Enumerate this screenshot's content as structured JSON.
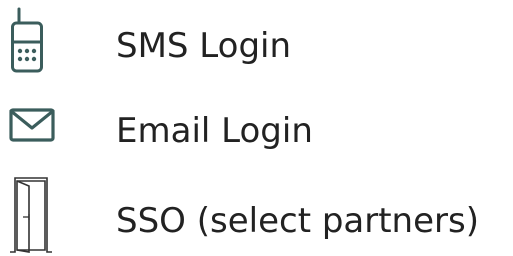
{
  "colors": {
    "icon": "#3b5d5c",
    "text": "#222222",
    "background": "#ffffff"
  },
  "options": [
    {
      "label": "SMS Login",
      "icon": "mobile-phone-icon"
    },
    {
      "label": "Email Login",
      "icon": "envelope-icon"
    },
    {
      "label": "SSO (select partners)",
      "icon": "door-icon"
    }
  ]
}
